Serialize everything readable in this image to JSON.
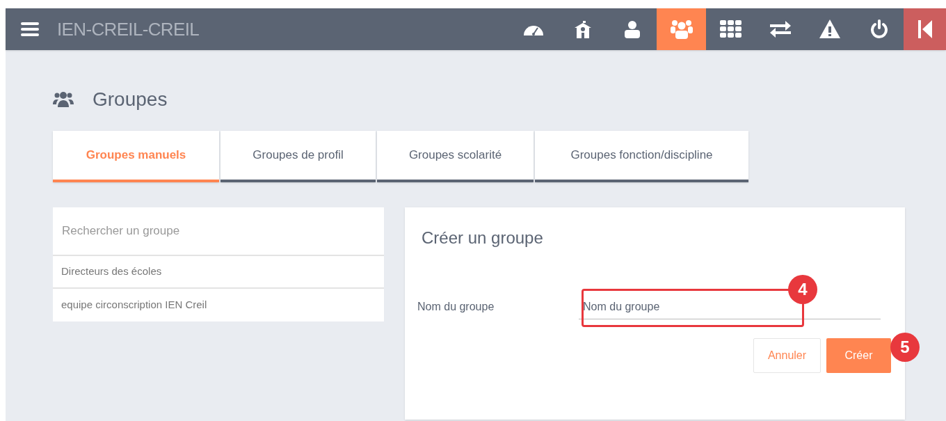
{
  "header": {
    "title": "IEN-CREIL-CREIL",
    "nav": [
      {
        "kind": "gauge",
        "selected": false
      },
      {
        "kind": "school",
        "selected": false
      },
      {
        "kind": "user",
        "selected": false
      },
      {
        "kind": "users",
        "selected": true
      },
      {
        "kind": "grid",
        "selected": false
      },
      {
        "kind": "swap",
        "selected": false
      },
      {
        "kind": "warning",
        "selected": false
      },
      {
        "kind": "power",
        "selected": false
      },
      {
        "kind": "collapse",
        "selected": false
      }
    ]
  },
  "page": {
    "title": "Groupes"
  },
  "tabs": [
    {
      "label": "Groupes manuels",
      "selected": true
    },
    {
      "label": "Groupes de profil",
      "selected": false
    },
    {
      "label": "Groupes scolarité",
      "selected": false
    },
    {
      "label": "Groupes fonction/discipline",
      "selected": false
    }
  ],
  "group_list": {
    "search": {
      "placeholder": "Rechercher un groupe"
    },
    "items": [
      "Directeurs des écoles",
      "equipe circonscription IEN Creil"
    ]
  },
  "create_form": {
    "title": "Créer un groupe",
    "field_label": "Nom du groupe",
    "field": {
      "placeholder": "Nom du groupe"
    },
    "buttons": [
      {
        "label": "Annuler",
        "kind": "secondary"
      },
      {
        "label": "Créer",
        "kind": "primary"
      }
    ]
  },
  "annotations": [
    {
      "label": "4"
    },
    {
      "label": "5"
    }
  ]
}
